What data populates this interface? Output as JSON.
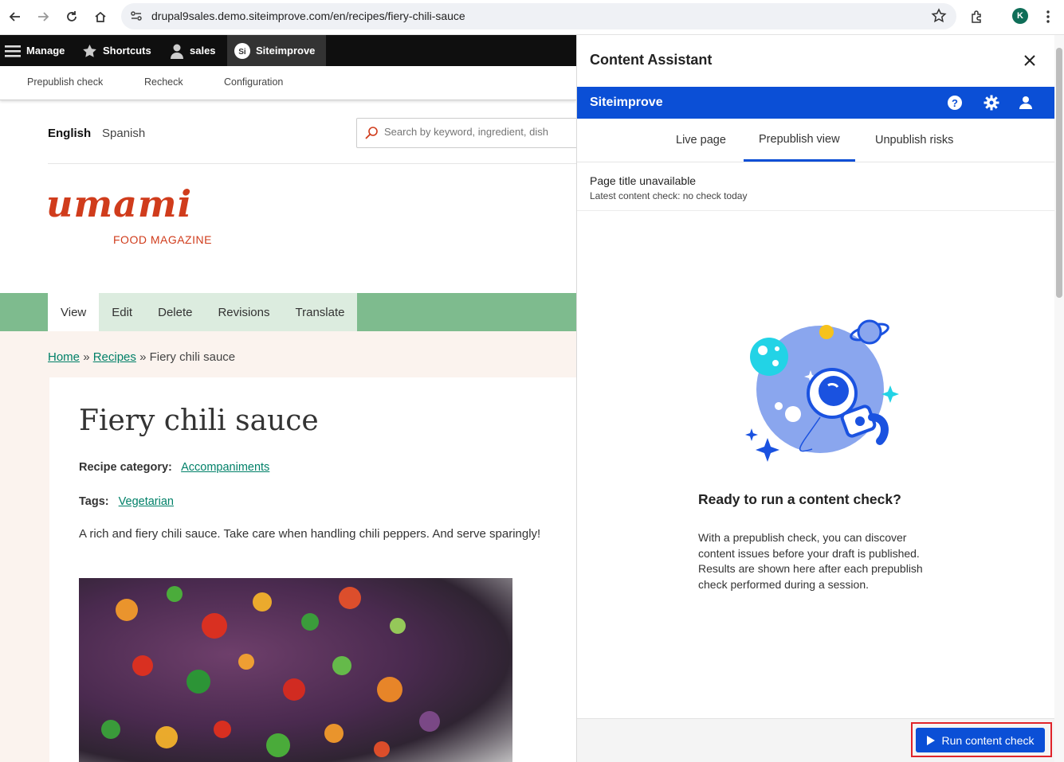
{
  "browser": {
    "url": "drupal9sales.demo.siteimprove.com/en/recipes/fiery-chili-sauce",
    "profile_initial": "K"
  },
  "toolbar": {
    "manage": "Manage",
    "shortcuts": "Shortcuts",
    "user": "sales",
    "siteimprove": "Siteimprove",
    "siteimprove_badge": "Si",
    "tray": [
      "Prepublish check",
      "Recheck",
      "Configuration"
    ]
  },
  "site": {
    "languages": [
      "English",
      "Spanish"
    ],
    "search_placeholder": "Search by keyword, ingredient, dish",
    "logo": "umami",
    "logo_sub": "FOOD MAGAZINE",
    "tabs": [
      "View",
      "Edit",
      "Delete",
      "Revisions",
      "Translate"
    ],
    "breadcrumb": {
      "home": "Home",
      "sep1": "»",
      "recipes": "Recipes",
      "sep2": "»",
      "current": "Fiery chili sauce"
    },
    "title": "Fiery chili sauce",
    "category_label": "Recipe category:",
    "category_value": "Accompaniments",
    "tags_label": "Tags:",
    "tags_value": "Vegetarian",
    "summary": "A rich and fiery chili sauce. Take care when handling chili peppers. And serve sparingly!"
  },
  "assistant": {
    "title": "Content Assistant",
    "brand": "Siteimprove",
    "tabs": [
      "Live page",
      "Prepublish view",
      "Unpublish risks"
    ],
    "active_tab": "Prepublish view",
    "page_title": "Page title unavailable",
    "latest_check": "Latest content check: no check today",
    "ready_heading": "Ready to run a content check?",
    "description": "With a prepublish check, you can discover content issues before your draft is published. Results are shown here after each prepublish check performed during a session.",
    "run_button": "Run content check",
    "colors": {
      "brand": "#0b4fd6",
      "highlight": "#e0242a"
    }
  }
}
